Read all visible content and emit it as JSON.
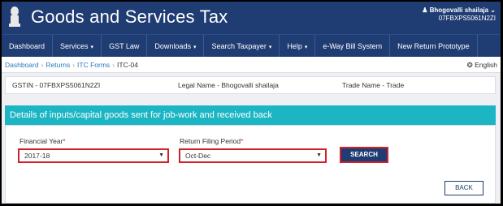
{
  "header": {
    "title": "Goods and Services Tax",
    "user_name": "Bhogovalli shailaja",
    "user_gstin": "07FBXPS5061N2ZI"
  },
  "nav": {
    "items": [
      {
        "label": "Dashboard",
        "caret": ""
      },
      {
        "label": "Services",
        "caret": "▾"
      },
      {
        "label": "GST Law",
        "caret": ""
      },
      {
        "label": "Downloads",
        "caret": "▾"
      },
      {
        "label": "Search Taxpayer",
        "caret": "▾"
      },
      {
        "label": "Help",
        "caret": "▾"
      },
      {
        "label": "e-Way Bill System",
        "caret": ""
      },
      {
        "label": "New Return Prototype",
        "caret": ""
      }
    ]
  },
  "breadcrumb": {
    "items": [
      "Dashboard",
      "Returns",
      "ITC Forms"
    ],
    "current": "ITC-04",
    "separator": "›",
    "language": "English"
  },
  "info": {
    "gstin": "GSTIN - 07FBXPS5061N2ZI",
    "legal_name": "Legal Name - Bhogovalli shailaja",
    "trade_name": "Trade Name - Trade"
  },
  "section": {
    "title": "Details of inputs/capital goods sent for job-work and received back"
  },
  "form": {
    "financial_year_label": "Financial Year",
    "financial_year_value": "2017-18",
    "period_label": "Return Filing Period",
    "period_value": "Oct-Dec",
    "required_mark": "*",
    "search_label": "SEARCH",
    "back_label": "BACK"
  },
  "colors": {
    "header_bg": "#1f3c73",
    "section_bg": "#1cb5c4",
    "highlight_border": "#d0202a"
  }
}
